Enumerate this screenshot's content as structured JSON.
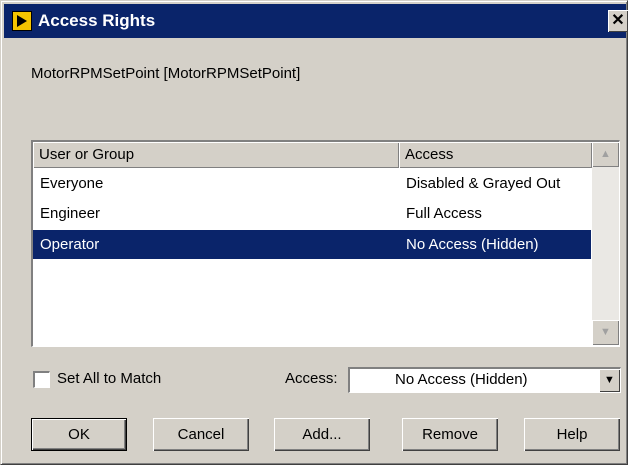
{
  "window": {
    "title": "Access Rights",
    "close_glyph": "✕"
  },
  "object_name": "MotorRPMSetPoint [MotorRPMSetPoint]",
  "list": {
    "columns": [
      "User or Group",
      "Access"
    ],
    "rows": [
      {
        "user": "Everyone",
        "access": "Disabled & Grayed Out",
        "selected": false
      },
      {
        "user": "Engineer",
        "access": "Full Access",
        "selected": false
      },
      {
        "user": "Operator",
        "access": "No Access (Hidden)",
        "selected": true
      }
    ]
  },
  "set_all": {
    "label": "Set All to Match",
    "checked": false
  },
  "access_combo": {
    "label": "Access:",
    "value": "No Access (Hidden)"
  },
  "buttons": {
    "ok": "OK",
    "cancel": "Cancel",
    "add": "Add...",
    "remove": "Remove",
    "help": "Help"
  },
  "icons": {
    "title_icon": "labview-vi-icon",
    "scroll_up": "arrow-up-icon",
    "scroll_down": "arrow-down-icon",
    "dropdown": "chevron-down-icon"
  },
  "colors": {
    "titlebar": "#0a246a",
    "selection": "#0a246a",
    "dialog_face": "#d4d0c8"
  }
}
